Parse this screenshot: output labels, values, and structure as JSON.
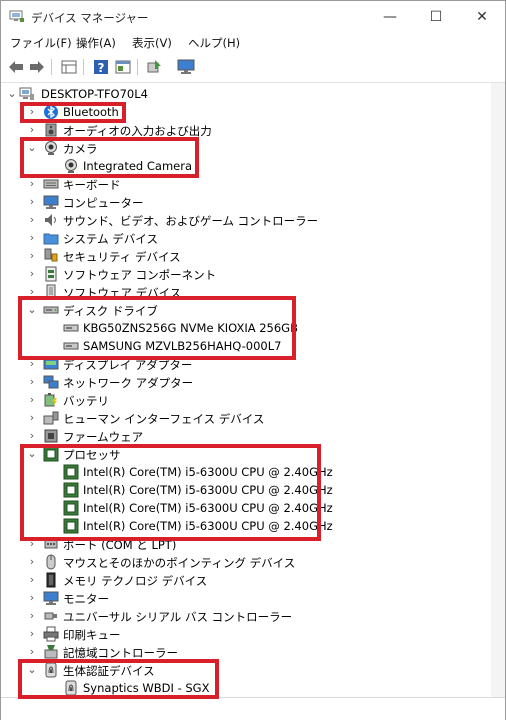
{
  "window": {
    "title": "デバイス マネージャー",
    "minimize_glyph": "—",
    "maximize_glyph": "☐",
    "close_glyph": "✕"
  },
  "menu": [
    "ファイル(F)",
    "操作(A)",
    "表示(V)",
    "ヘルプ(H)"
  ],
  "toolbar": [
    "back-arrow-icon",
    "forward-arrow-icon",
    "properties-grid-icon",
    "help-icon",
    "view-panel-icon",
    "update-driver-icon",
    "monitor-icon"
  ],
  "tree": {
    "root": "DESKTOP-TFO70L4",
    "nodes": [
      {
        "label": "Bluetooth",
        "icon": "bluetooth-icon",
        "expander": "›"
      },
      {
        "label": "オーディオの入力および出力",
        "icon": "speaker-icon",
        "expander": "›"
      },
      {
        "label": "カメラ",
        "icon": "camera-icon",
        "expander": "⌄",
        "children": [
          "Integrated Camera"
        ]
      },
      {
        "label": "キーボード",
        "icon": "keyboard-icon",
        "expander": "›"
      },
      {
        "label": "コンピューター",
        "icon": "computer-icon",
        "expander": "›"
      },
      {
        "label": "サウンド、ビデオ、およびゲーム コントローラー",
        "icon": "sound-icon",
        "expander": "›"
      },
      {
        "label": "システム デバイス",
        "icon": "system-folder-icon",
        "expander": "›"
      },
      {
        "label": "セキュリティ デバイス",
        "icon": "security-key-icon",
        "expander": "›"
      },
      {
        "label": "ソフトウェア コンポーネント",
        "icon": "software-component-icon",
        "expander": "›"
      },
      {
        "label": "ソフトウェア デバイス",
        "icon": "software-device-icon",
        "expander": "›"
      },
      {
        "label": "ディスク ドライブ",
        "icon": "disk-drive-icon",
        "expander": "⌄",
        "children": [
          "KBG50ZNS256G NVMe KIOXIA 256GB",
          "SAMSUNG MZVLB256HAHQ-000L7"
        ]
      },
      {
        "label": "ディスプレイ アダプター",
        "icon": "display-adapter-icon",
        "expander": "›"
      },
      {
        "label": "ネットワーク アダプター",
        "icon": "network-adapter-icon",
        "expander": "›"
      },
      {
        "label": "バッテリ",
        "icon": "battery-icon",
        "expander": "›"
      },
      {
        "label": "ヒューマン インターフェイス デバイス",
        "icon": "hid-icon",
        "expander": "›"
      },
      {
        "label": "ファームウェア",
        "icon": "firmware-icon",
        "expander": "›"
      },
      {
        "label": "プロセッサ",
        "icon": "processor-icon",
        "expander": "⌄",
        "children": [
          "Intel(R) Core(TM) i5-6300U CPU @ 2.40GHz",
          "Intel(R) Core(TM) i5-6300U CPU @ 2.40GHz",
          "Intel(R) Core(TM) i5-6300U CPU @ 2.40GHz",
          "Intel(R) Core(TM) i5-6300U CPU @ 2.40GHz"
        ]
      },
      {
        "label": "ポート (COM と LPT)",
        "icon": "port-icon",
        "expander": "›"
      },
      {
        "label": "マウスとそのほかのポインティング デバイス",
        "icon": "mouse-icon",
        "expander": "›"
      },
      {
        "label": "メモリ テクノロジ デバイス",
        "icon": "memory-icon",
        "expander": "›"
      },
      {
        "label": "モニター",
        "icon": "monitor-icon",
        "expander": "›"
      },
      {
        "label": "ユニバーサル シリアル バス コントローラー",
        "icon": "usb-icon",
        "expander": "›"
      },
      {
        "label": "印刷キュー",
        "icon": "printer-icon",
        "expander": "›"
      },
      {
        "label": "記憶域コントローラー",
        "icon": "storage-controller-icon",
        "expander": "›"
      },
      {
        "label": "生体認証デバイス",
        "icon": "fingerprint-icon",
        "expander": "⌄",
        "children": [
          "Synaptics WBDI - SGX"
        ]
      }
    ]
  },
  "colors": {
    "highlight": "#d8202a",
    "folder": "#4a90d9"
  }
}
